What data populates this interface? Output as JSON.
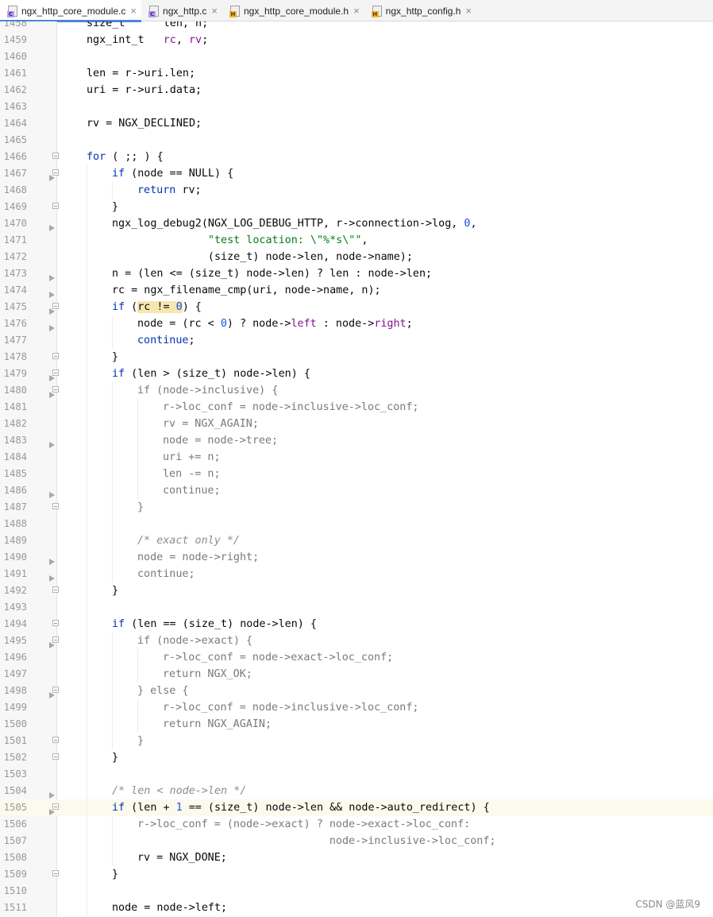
{
  "tabs": [
    {
      "label": "ngx_http_core_module.c",
      "icon": "c-file-icon",
      "active": true
    },
    {
      "label": "ngx_http.c",
      "icon": "c-file-icon",
      "active": false
    },
    {
      "label": "ngx_http_core_module.h",
      "icon": "h-file-icon",
      "active": false
    },
    {
      "label": "ngx_http_config.h",
      "icon": "h-file-icon",
      "active": false
    }
  ],
  "close_glyph": "×",
  "current_line": 1505,
  "code_lines": [
    {
      "n": "1458",
      "indent": 0,
      "t": [
        [
          "",
          "size_t      len, n;"
        ]
      ]
    },
    {
      "n": "1459",
      "indent": 0,
      "t": [
        [
          "",
          "ngx_int_t   "
        ],
        [
          "fld",
          "rc"
        ],
        [
          "",
          ", "
        ],
        [
          "fld",
          "rv"
        ],
        [
          "",
          ";"
        ]
      ]
    },
    {
      "n": "1460",
      "indent": 0,
      "t": []
    },
    {
      "n": "1461",
      "indent": 0,
      "t": [
        [
          "",
          "len = r->uri.len;"
        ]
      ]
    },
    {
      "n": "1462",
      "indent": 0,
      "t": [
        [
          "",
          "uri = r->uri.data;"
        ]
      ]
    },
    {
      "n": "1463",
      "indent": 0,
      "t": []
    },
    {
      "n": "1464",
      "indent": 0,
      "t": [
        [
          "",
          "rv = NGX_DECLINED;"
        ]
      ]
    },
    {
      "n": "1465",
      "indent": 0,
      "t": []
    },
    {
      "n": "1466",
      "indent": 0,
      "fold": true,
      "t": [
        [
          "kw",
          "for"
        ],
        [
          "",
          " ( ;; ) {"
        ]
      ]
    },
    {
      "n": "1467",
      "indent": 1,
      "fold": true,
      "marker": true,
      "t": [
        [
          "kw",
          "if"
        ],
        [
          "",
          " (node == NULL) {"
        ]
      ]
    },
    {
      "n": "1468",
      "indent": 2,
      "t": [
        [
          "kw",
          "return"
        ],
        [
          "",
          " rv;"
        ]
      ]
    },
    {
      "n": "1469",
      "indent": 1,
      "fold": true,
      "t": [
        [
          "",
          "}"
        ]
      ]
    },
    {
      "n": "1470",
      "indent": 1,
      "marker": true,
      "t": [
        [
          "",
          "ngx_log_debug2(NGX_LOG_DEBUG_HTTP, r->connection->log, "
        ],
        [
          "num",
          "0"
        ],
        [
          "",
          ","
        ]
      ]
    },
    {
      "n": "1471",
      "indent": 1,
      "t": [
        [
          "",
          "               "
        ],
        [
          "str",
          "\"test location: \\\"%*s\\\"\""
        ],
        [
          "",
          ","
        ]
      ]
    },
    {
      "n": "1472",
      "indent": 1,
      "t": [
        [
          "",
          "               (size_t) node->len, node->name);"
        ]
      ]
    },
    {
      "n": "1473",
      "indent": 1,
      "marker": true,
      "t": [
        [
          "",
          "n = (len <= (size_t) node->len) ? len : node->len;"
        ]
      ]
    },
    {
      "n": "1474",
      "indent": 1,
      "marker": true,
      "t": [
        [
          "",
          "rc = ngx_filename_cmp(uri, node->name, n);"
        ]
      ]
    },
    {
      "n": "1475",
      "indent": 1,
      "fold": true,
      "marker": true,
      "t": [
        [
          "kw",
          "if"
        ],
        [
          "",
          " ("
        ],
        [
          "hl",
          "rc != "
        ],
        [
          "num hl",
          "0"
        ],
        [
          "",
          ") {"
        ]
      ]
    },
    {
      "n": "1476",
      "indent": 2,
      "marker": true,
      "t": [
        [
          "",
          "node = (rc < "
        ],
        [
          "num",
          "0"
        ],
        [
          "",
          ") ? node->"
        ],
        [
          "fld",
          "left"
        ],
        [
          "",
          " : node->"
        ],
        [
          "fld",
          "right"
        ],
        [
          "",
          ";"
        ]
      ]
    },
    {
      "n": "1477",
      "indent": 2,
      "t": [
        [
          "kw",
          "continue"
        ],
        [
          "",
          ";"
        ]
      ]
    },
    {
      "n": "1478",
      "indent": 1,
      "fold": true,
      "t": [
        [
          "",
          "}"
        ]
      ]
    },
    {
      "n": "1479",
      "indent": 1,
      "fold": true,
      "marker": true,
      "t": [
        [
          "kw",
          "if"
        ],
        [
          "",
          " (len > (size_t) node->len) {"
        ]
      ]
    },
    {
      "n": "1480",
      "indent": 2,
      "fold": true,
      "marker": true,
      "t": [
        [
          "dim",
          "if (node->inclusive) {"
        ]
      ]
    },
    {
      "n": "1481",
      "indent": 3,
      "t": [
        [
          "dim",
          "r->loc_conf = node->inclusive->loc_conf;"
        ]
      ]
    },
    {
      "n": "1482",
      "indent": 3,
      "t": [
        [
          "dim",
          "rv = NGX_AGAIN;"
        ]
      ]
    },
    {
      "n": "1483",
      "indent": 3,
      "marker": true,
      "t": [
        [
          "dim",
          "node = node->tree;"
        ]
      ]
    },
    {
      "n": "1484",
      "indent": 3,
      "t": [
        [
          "dim",
          "uri += n;"
        ]
      ]
    },
    {
      "n": "1485",
      "indent": 3,
      "t": [
        [
          "dim",
          "len -= n;"
        ]
      ]
    },
    {
      "n": "1486",
      "indent": 3,
      "marker": true,
      "t": [
        [
          "dim",
          "continue;"
        ]
      ]
    },
    {
      "n": "1487",
      "indent": 2,
      "fold": true,
      "t": [
        [
          "dim",
          "}"
        ]
      ]
    },
    {
      "n": "1488",
      "indent": 2,
      "t": []
    },
    {
      "n": "1489",
      "indent": 2,
      "t": [
        [
          "cmt",
          "/* exact only */"
        ]
      ]
    },
    {
      "n": "1490",
      "indent": 2,
      "marker": true,
      "t": [
        [
          "dim",
          "node = node->right;"
        ]
      ]
    },
    {
      "n": "1491",
      "indent": 2,
      "marker": true,
      "t": [
        [
          "dim",
          "continue;"
        ]
      ]
    },
    {
      "n": "1492",
      "indent": 1,
      "fold": true,
      "t": [
        [
          "",
          "}"
        ]
      ]
    },
    {
      "n": "1493",
      "indent": 1,
      "t": []
    },
    {
      "n": "1494",
      "indent": 1,
      "fold": true,
      "t": [
        [
          "kw",
          "if"
        ],
        [
          "",
          " (len == (size_t) node->len) {"
        ]
      ]
    },
    {
      "n": "1495",
      "indent": 2,
      "fold": true,
      "marker": true,
      "t": [
        [
          "dim",
          "if (node->exact) {"
        ]
      ]
    },
    {
      "n": "1496",
      "indent": 3,
      "t": [
        [
          "dim",
          "r->loc_conf = node->exact->loc_conf;"
        ]
      ]
    },
    {
      "n": "1497",
      "indent": 3,
      "t": [
        [
          "dim",
          "return NGX_OK;"
        ]
      ]
    },
    {
      "n": "1498",
      "indent": 2,
      "fold": true,
      "marker": true,
      "t": [
        [
          "dim",
          "} else {"
        ]
      ]
    },
    {
      "n": "1499",
      "indent": 3,
      "t": [
        [
          "dim",
          "r->loc_conf = node->inclusive->loc_conf;"
        ]
      ]
    },
    {
      "n": "1500",
      "indent": 3,
      "t": [
        [
          "dim",
          "return NGX_AGAIN;"
        ]
      ]
    },
    {
      "n": "1501",
      "indent": 2,
      "fold": true,
      "t": [
        [
          "dim",
          "}"
        ]
      ]
    },
    {
      "n": "1502",
      "indent": 1,
      "fold": true,
      "t": [
        [
          "",
          "}"
        ]
      ]
    },
    {
      "n": "1503",
      "indent": 1,
      "t": []
    },
    {
      "n": "1504",
      "indent": 1,
      "marker": true,
      "t": [
        [
          "cmt",
          "/* len < node->len */"
        ]
      ]
    },
    {
      "n": "1505",
      "indent": 1,
      "fold": true,
      "marker": true,
      "t": [
        [
          "kw",
          "if"
        ],
        [
          "",
          " (len + "
        ],
        [
          "num",
          "1"
        ],
        [
          "",
          " == (size_t) node->len && node->auto_redirect) {"
        ]
      ]
    },
    {
      "n": "1506",
      "indent": 2,
      "t": [
        [
          "dim",
          "r->loc_conf = (node->exact) ? node->exact->loc_conf:"
        ]
      ]
    },
    {
      "n": "1507",
      "indent": 2,
      "t": [
        [
          "dim",
          "                              node->inclusive->loc_conf;"
        ]
      ]
    },
    {
      "n": "1508",
      "indent": 2,
      "t": [
        [
          "",
          "rv = NGX_DONE;"
        ]
      ]
    },
    {
      "n": "1509",
      "indent": 1,
      "fold": true,
      "t": [
        [
          "",
          "}"
        ]
      ]
    },
    {
      "n": "1510",
      "indent": 1,
      "t": []
    },
    {
      "n": "1511",
      "indent": 1,
      "t": [
        [
          "",
          "node = node->left;"
        ]
      ]
    }
  ],
  "watermark": "CSDN @蓝风9",
  "colors": {
    "keyword": "#0033b3",
    "number": "#1750eb",
    "string": "#067d17",
    "field": "#871094",
    "comment": "#8c8c8c",
    "active_tab_underline": "#4a86d8"
  }
}
